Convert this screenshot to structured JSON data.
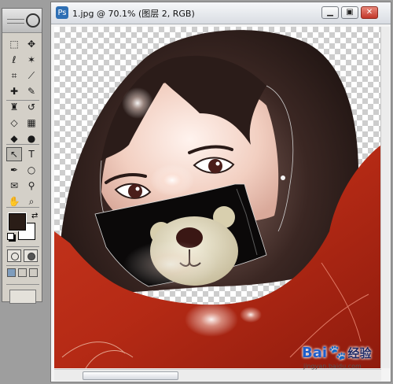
{
  "document": {
    "title": "1.jpg @ 70.1% (图层 2, RGB)",
    "app_icon": "photoshop-document-icon",
    "controls": [
      "minimize-icon",
      "restore-icon",
      "close-icon"
    ]
  },
  "toolbox": {
    "tools": [
      {
        "name": "rectangular-marquee-tool",
        "glyph": "⬚"
      },
      {
        "name": "move-tool",
        "glyph": "✥"
      },
      {
        "name": "lasso-tool",
        "glyph": "ℓ"
      },
      {
        "name": "magic-wand-tool",
        "glyph": "✶"
      },
      {
        "name": "crop-tool",
        "glyph": "⌗"
      },
      {
        "name": "slice-tool",
        "glyph": "⟋"
      },
      {
        "name": "healing-brush-tool",
        "glyph": "✚"
      },
      {
        "name": "brush-tool",
        "glyph": "✎"
      },
      {
        "name": "clone-stamp-tool",
        "glyph": "♜"
      },
      {
        "name": "history-brush-tool",
        "glyph": "↺"
      },
      {
        "name": "eraser-tool",
        "glyph": "◇"
      },
      {
        "name": "gradient-tool",
        "glyph": "▦"
      },
      {
        "name": "blur-tool",
        "glyph": "◆"
      },
      {
        "name": "dodge-tool",
        "glyph": "●"
      },
      {
        "name": "path-selection-tool",
        "glyph": "↖"
      },
      {
        "name": "type-tool",
        "glyph": "T"
      },
      {
        "name": "pen-tool",
        "glyph": "✒"
      },
      {
        "name": "ellipse-shape-tool",
        "glyph": "○"
      },
      {
        "name": "notes-tool",
        "glyph": "✉"
      },
      {
        "name": "eyedropper-tool",
        "glyph": "⚲"
      },
      {
        "name": "hand-tool",
        "glyph": "✋"
      },
      {
        "name": "zoom-tool",
        "glyph": "⌕"
      }
    ],
    "selected_tool": "path-selection-tool",
    "foreground_color": "#2a1d17",
    "background_color": "#ffffff"
  },
  "watermark": {
    "brand": "Bai",
    "paw_icon": "baidu-paw-icon",
    "product": "经验",
    "url": "jingyan.baidu.com"
  }
}
